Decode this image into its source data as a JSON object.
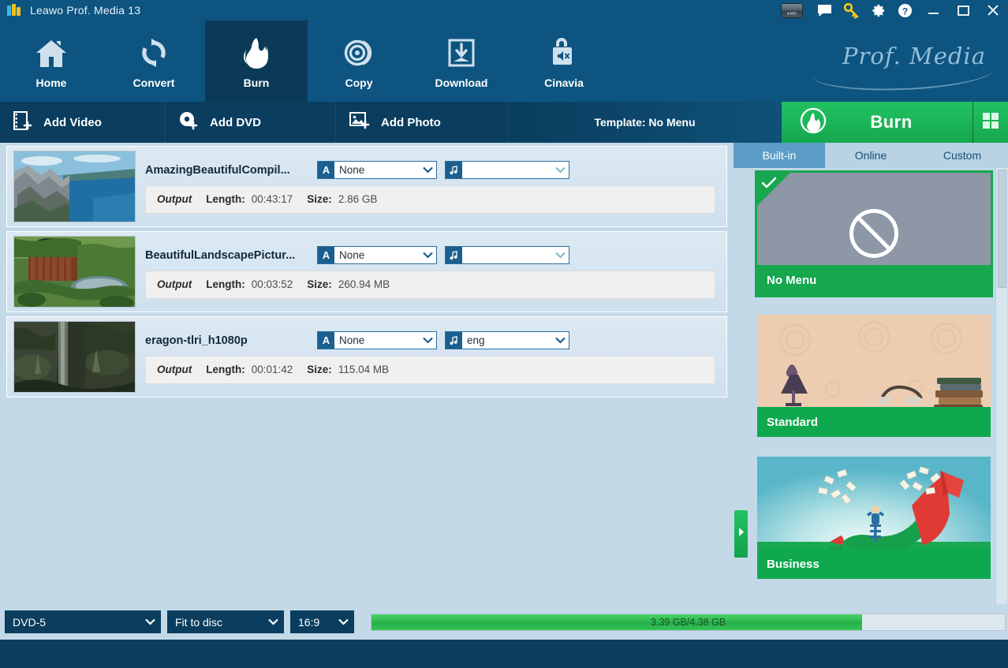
{
  "window": {
    "title": "Leawo Prof. Media 13",
    "logo_icon": "leawo-logo-icon",
    "controls": {
      "amd_badge": "AMD",
      "feedback_icon": "chat-bubble-icon",
      "key_icon": "key-icon",
      "settings_icon": "gear-icon",
      "help_icon": "help-circle-icon",
      "minimize": "minimize-icon",
      "maximize": "maximize-icon",
      "close": "close-icon"
    }
  },
  "brand": {
    "text": "Prof. Media"
  },
  "mainnav": {
    "items": [
      {
        "label": "Home",
        "icon": "home-icon",
        "active": false
      },
      {
        "label": "Convert",
        "icon": "convert-arrows-icon",
        "active": false
      },
      {
        "label": "Burn",
        "icon": "flame-icon",
        "active": true
      },
      {
        "label": "Copy",
        "icon": "disc-icon",
        "active": false
      },
      {
        "label": "Download",
        "icon": "download-tray-icon",
        "active": false
      },
      {
        "label": "Cinavia",
        "icon": "speaker-mute-icon",
        "active": false
      }
    ]
  },
  "toolbar": {
    "add_video": "Add Video",
    "add_video_icon": "film-plus-icon",
    "add_dvd": "Add DVD",
    "add_dvd_icon": "disc-plus-icon",
    "add_photo": "Add Photo",
    "add_photo_icon": "image-plus-icon",
    "template_label": "Template: No Menu",
    "burn_label": "Burn",
    "burn_icon": "flame-circle-icon",
    "grid_icon": "grid-squares-icon",
    "burn_color": "#16a74f"
  },
  "filelist": {
    "items": [
      {
        "name": "AmazingBeautifulCompil...",
        "subtitle_label": "A",
        "subtitle_value": "None",
        "audio_label": "music-note-icon",
        "audio_value": "",
        "output_label": "Output",
        "length_key": "Length:",
        "length_value": "00:43:17",
        "size_key": "Size:",
        "size_value": "2.86 GB",
        "thumb": "coastal-cliffs"
      },
      {
        "name": "BeautifulLandscapePictur...",
        "subtitle_label": "A",
        "subtitle_value": "None",
        "audio_label": "music-note-icon",
        "audio_value": "",
        "output_label": "Output",
        "length_key": "Length:",
        "length_value": "00:03:52",
        "size_key": "Size:",
        "size_value": "260.94 MB",
        "thumb": "garden-pond"
      },
      {
        "name": "eragon-tlri_h1080p",
        "subtitle_label": "A",
        "subtitle_value": "None",
        "audio_label": "music-note-icon",
        "audio_value": "eng",
        "output_label": "Output",
        "length_key": "Length:",
        "length_value": "00:01:42",
        "size_key": "Size:",
        "size_value": "115.04 MB",
        "thumb": "forest-waterfall"
      }
    ]
  },
  "collapse_handle": {
    "icon": "chevron-right-icon"
  },
  "rightpanel": {
    "tabs": [
      {
        "label": "Built-in",
        "active": true
      },
      {
        "label": "Online",
        "active": false
      },
      {
        "label": "Custom",
        "active": false
      }
    ],
    "templates": [
      {
        "label": "No Menu",
        "selected": true,
        "icon": "no-entry-icon"
      },
      {
        "label": "Standard",
        "selected": false,
        "icon": "standard-scene"
      },
      {
        "label": "Business",
        "selected": false,
        "icon": "business-scene"
      }
    ]
  },
  "bottombar": {
    "disc_type": "DVD-5",
    "quality": "Fit to disc",
    "aspect_ratio": "16:9",
    "progress_text": "3.39 GB/4.38 GB",
    "progress_percent": 77.4
  }
}
